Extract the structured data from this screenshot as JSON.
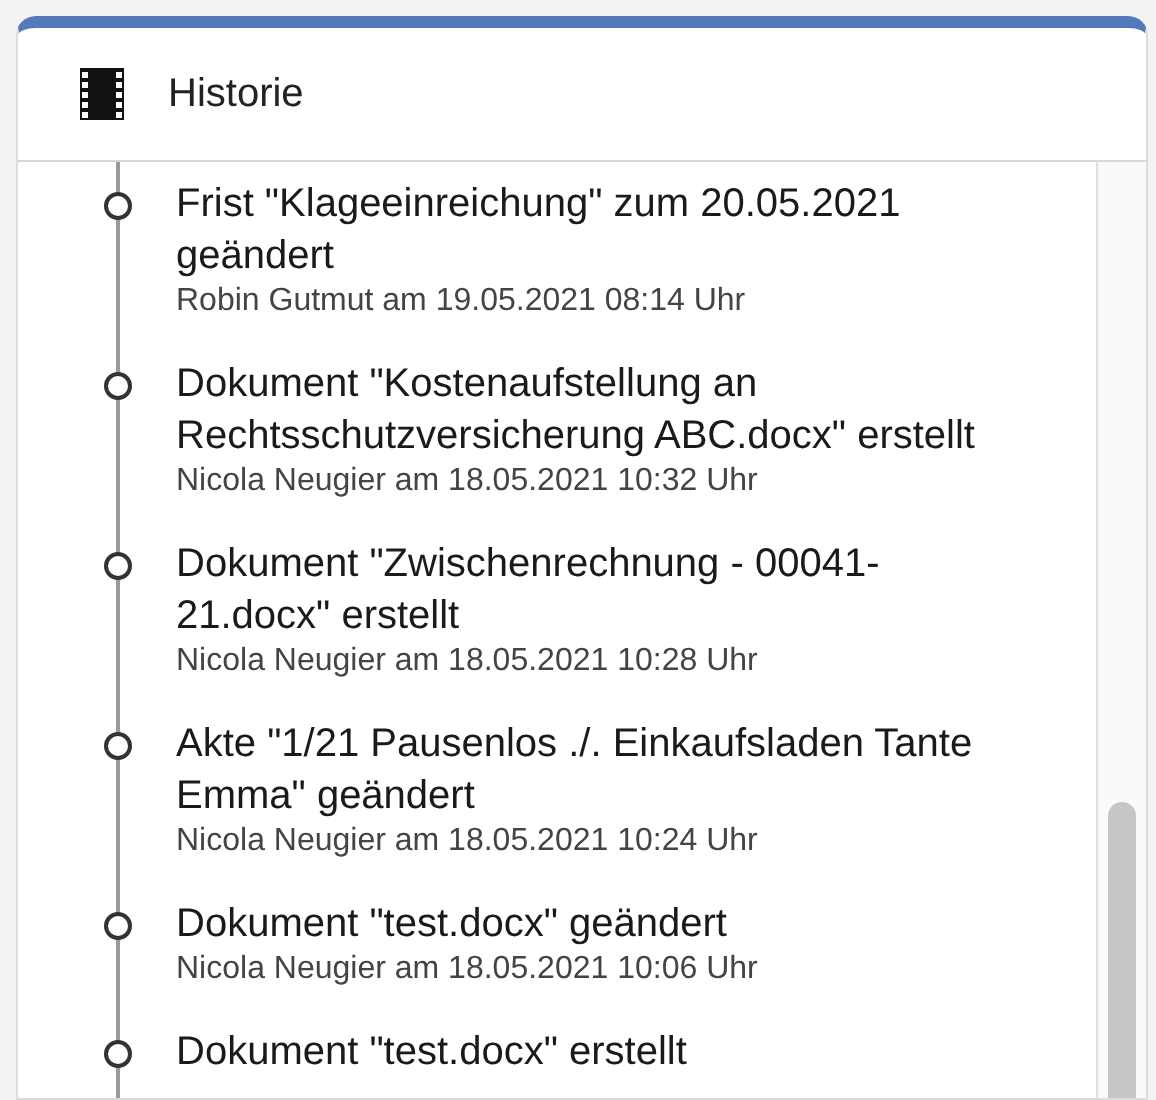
{
  "panel": {
    "title": "Historie"
  },
  "entries": [
    {
      "text": "Frist \"Klageeinreichung\" zum 20.05.2021 geändert",
      "meta": "Robin Gutmut am 19.05.2021 08:14 Uhr"
    },
    {
      "text": "Dokument \"Kostenaufstellung an Rechtsschutzversicherung ABC.docx\" erstellt",
      "meta": "Nicola Neugier am 18.05.2021 10:32 Uhr"
    },
    {
      "text": "Dokument \"Zwischenrechnung - 00041-21.docx\" erstellt",
      "meta": "Nicola Neugier am 18.05.2021 10:28 Uhr"
    },
    {
      "text": "Akte \"1/21 Pausenlos ./. Einkaufsladen Tante Emma\" geändert",
      "meta": "Nicola Neugier am 18.05.2021 10:24 Uhr"
    },
    {
      "text": "Dokument \"test.docx\" geändert",
      "meta": "Nicola Neugier am 18.05.2021 10:06 Uhr"
    },
    {
      "text": "Dokument \"test.docx\" erstellt"
    }
  ]
}
